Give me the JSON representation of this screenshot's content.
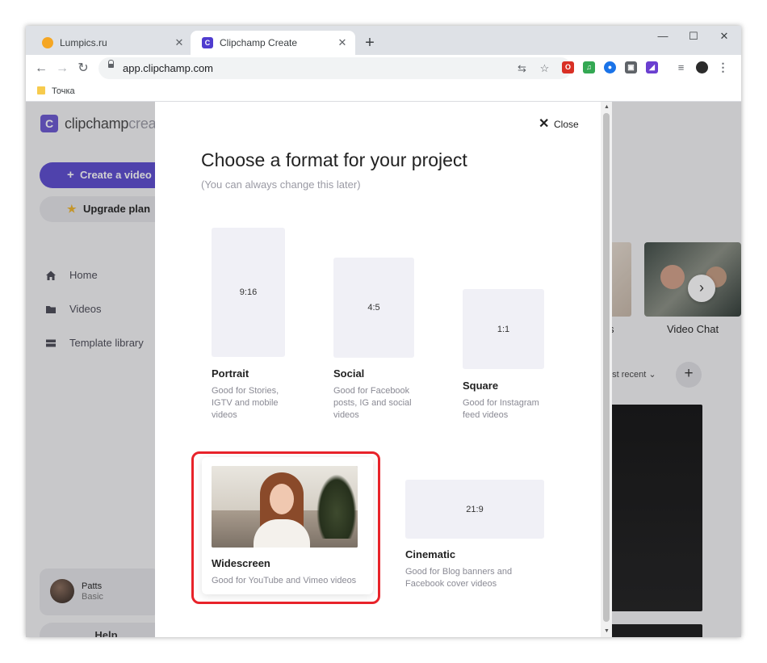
{
  "browser": {
    "tabs": [
      {
        "title": "Lumpics.ru",
        "favicon_color": "#f5a623",
        "active": false
      },
      {
        "title": "Clipchamp Create",
        "favicon_letter": "C",
        "active": true
      }
    ],
    "new_tab_symbol": "+",
    "window_controls": {
      "minimize": "—",
      "maximize": "☐",
      "close": "✕"
    },
    "url": "app.clipchamp.com",
    "bookmark": "Точка"
  },
  "app": {
    "logo_letter": "C",
    "logo_brand": "clipchamp",
    "logo_product": "create",
    "create_video": "Create a video",
    "upgrade_plan": "Upgrade plan",
    "nav": [
      {
        "label": "Home"
      },
      {
        "label": "Videos"
      },
      {
        "label": "Template library"
      }
    ],
    "user": {
      "name": "Patts",
      "plan": "Basic"
    },
    "help": "Help",
    "template_labels": {
      "left_partial": "s",
      "right": "Video Chat"
    },
    "sort_label": "ost recent ⌄",
    "add_symbol": "+"
  },
  "modal": {
    "close_label": "Close",
    "title": "Choose a format for your project",
    "subtitle": "(You can always change this later)",
    "formats": [
      {
        "name": "Portrait",
        "ratio": "9:16",
        "description_lines": [
          "Good for Stories,",
          "IGTV and mobile",
          "videos"
        ]
      },
      {
        "name": "Social",
        "ratio": "4:5",
        "description_lines": [
          "Good for Facebook",
          "posts, IG and social",
          "videos"
        ]
      },
      {
        "name": "Square",
        "ratio": "1:1",
        "description_lines": [
          "Good for Instagram",
          "feed videos"
        ]
      },
      {
        "name": "Widescreen",
        "ratio": "",
        "description_lines": [
          "Good for YouTube and Vimeo videos"
        ],
        "highlighted": true
      },
      {
        "name": "Cinematic",
        "ratio": "21:9",
        "description_lines": [
          "Good for Blog banners and",
          "Facebook cover videos"
        ]
      }
    ]
  },
  "colors": {
    "accent": "#5a4ad0",
    "highlight_border": "#e8232a",
    "shape_fill": "#f0f0f6"
  }
}
